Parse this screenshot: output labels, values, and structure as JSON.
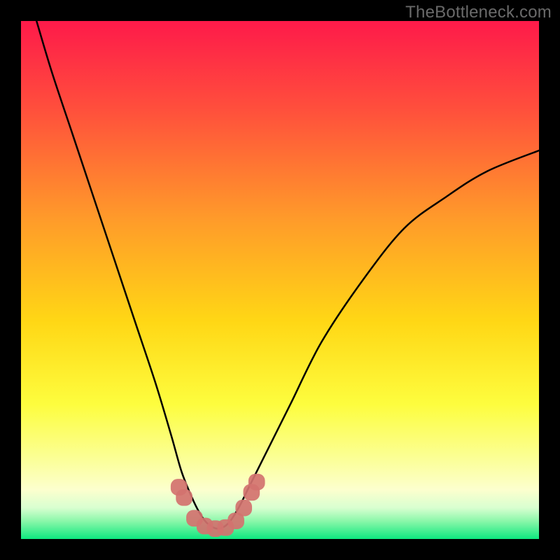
{
  "watermark": "TheBottleneck.com",
  "colors": {
    "frame": "#000000",
    "top": "#fe1a4a",
    "mid_upper": "#ff8d2c",
    "mid": "#ffe112",
    "mid_lower": "#fcff5a",
    "pale_band": "#fdffb7",
    "green_start": "#d7ffd1",
    "green_end": "#0ee87f",
    "curve": "#000000",
    "marker": "#d2726f"
  },
  "chart_data": {
    "type": "line",
    "title": "",
    "xlabel": "",
    "ylabel": "",
    "xlim": [
      0,
      100
    ],
    "ylim": [
      0,
      100
    ],
    "grid": false,
    "note": "Axes are normalized 0–100 because the source graphic has no visible tick labels. Y is plotted with 0 at the bottom.",
    "series": [
      {
        "name": "bottleneck-deviation-curve",
        "x": [
          3,
          6,
          10,
          14,
          18,
          22,
          26,
          29,
          31,
          33,
          34.5,
          36,
          38,
          40,
          42,
          44,
          47,
          52,
          58,
          66,
          74,
          82,
          90,
          100
        ],
        "y": [
          100,
          90,
          78,
          66,
          54,
          42,
          30,
          20,
          13,
          8,
          5,
          3,
          2,
          3,
          6,
          10,
          16,
          26,
          38,
          50,
          60,
          66,
          71,
          75
        ]
      }
    ],
    "markers": {
      "name": "highlight-points",
      "x": [
        30.5,
        31.5,
        33.5,
        35.5,
        37.5,
        39.5,
        41.5,
        43,
        44.5,
        45.5
      ],
      "y": [
        10,
        8,
        4,
        2.5,
        2,
        2.2,
        3.5,
        6,
        9,
        11
      ],
      "style": "rounded-square",
      "color": "#d2726f",
      "size": 3.2
    }
  }
}
